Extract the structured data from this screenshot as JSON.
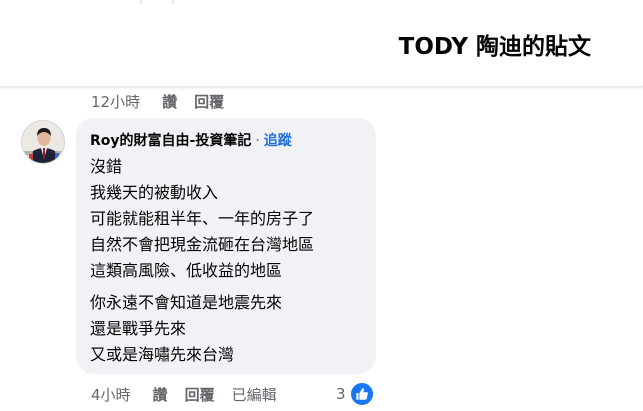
{
  "header": {
    "title": "TODY 陶迪的貼文"
  },
  "prev_comment_actions": {
    "time": "12小時",
    "like": "讚",
    "reply": "回覆"
  },
  "comment": {
    "author": "Roy的財富自由-投資筆記",
    "separator": "·",
    "follow": "追蹤",
    "paragraph1": [
      "沒錯",
      "我幾天的被動收入",
      "可能就能租半年、一年的房子了",
      "自然不會把現金流砸在台灣地區",
      "這類高風險、低收益的地區"
    ],
    "paragraph2": [
      "你永遠不會知道是地震先來",
      "還是戰爭先來",
      "又或是海嘯先來台灣"
    ],
    "actions": {
      "time": "4小時",
      "like": "讚",
      "reply": "回覆",
      "edited": "已編輯"
    },
    "reactions": {
      "count": "3",
      "icon": "thumbs-up-icon",
      "color": "#1877f2"
    }
  },
  "colors": {
    "link": "#216fdb",
    "bubble": "#f0f2f5",
    "meta": "#65676b"
  }
}
